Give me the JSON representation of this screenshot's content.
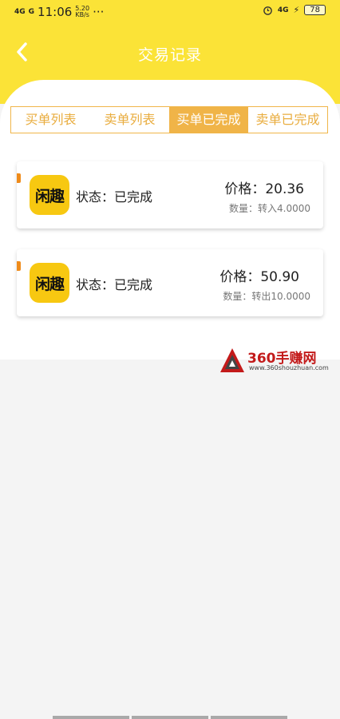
{
  "status_bar": {
    "signal1": "4G",
    "signal2": "G",
    "time": "11:06",
    "speed": "5.20\nKB/s",
    "dots": "···",
    "net": "4G",
    "battery": "78"
  },
  "header": {
    "title": "交易记录"
  },
  "tabs": [
    {
      "label": "买单列表",
      "active": false
    },
    {
      "label": "卖单列表",
      "active": false
    },
    {
      "label": "买单已完成",
      "active": true
    },
    {
      "label": "卖单已完成",
      "active": false
    }
  ],
  "records": [
    {
      "app_name": "闲趣",
      "status": "状态：已完成",
      "price": "价格：20.36",
      "quantity": "数量：转入4.0000"
    },
    {
      "app_name": "闲趣",
      "status": "状态：已完成",
      "price": "价格：50.90",
      "quantity": "数量：转出10.0000"
    }
  ],
  "watermark": {
    "name": "360手赚网",
    "url": "www.360shouzhuan.com"
  },
  "colors": {
    "header": "#fbe337",
    "accent": "#f0b448",
    "icon": "#f7c811",
    "mark": "#ef8b1a"
  }
}
